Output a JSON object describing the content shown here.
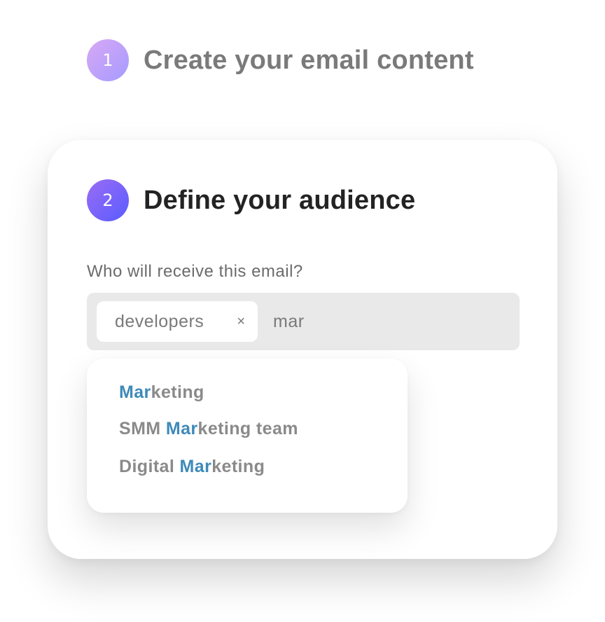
{
  "steps": {
    "step1": {
      "number": "1",
      "title": "Create your email content"
    },
    "step2": {
      "number": "2",
      "title": "Define your audience"
    }
  },
  "audience": {
    "prompt": "Who will receive this email?",
    "chips": [
      {
        "label": "developers",
        "remove_glyph": "×"
      }
    ],
    "typed_query": "mar"
  },
  "suggestions": [
    {
      "before": "",
      "match": "Mar",
      "after": "keting"
    },
    {
      "before": "SMM ",
      "match": "Mar",
      "after": "keting team"
    },
    {
      "before": "Digital ",
      "match": "Mar",
      "after": "keting"
    }
  ],
  "colors": {
    "highlight": "#3e8ab8",
    "badge1_gradient": [
      "#d8a8f5",
      "#a59bff"
    ],
    "badge2_gradient": [
      "#9a6cf5",
      "#5a5cff"
    ],
    "input_background": "#e9e9e9"
  },
  "icons": {
    "chip_remove": "close-icon"
  }
}
